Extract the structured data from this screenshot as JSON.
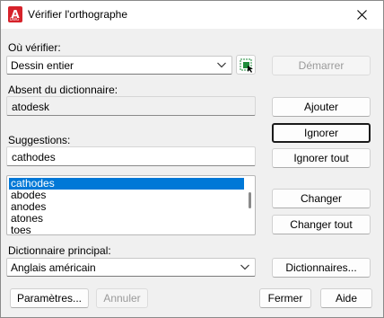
{
  "window": {
    "title": "Vérifier l'orthographe",
    "app_icon_letter": "A",
    "app_icon_sub": "DWG"
  },
  "where_to_check": {
    "label": "Où vérifier:",
    "value": "Dessin entier",
    "start_button": "Démarrer"
  },
  "not_in_dictionary": {
    "label": "Absent du dictionnaire:",
    "value": "atodesk"
  },
  "suggestions": {
    "label": "Suggestions:",
    "value": "cathodes",
    "items": [
      "cathodes",
      "abodes",
      "anodes",
      "atones",
      "toes"
    ],
    "selected_index": 0
  },
  "actions": {
    "add": "Ajouter",
    "ignore": "Ignorer",
    "ignore_all": "Ignorer tout",
    "change": "Changer",
    "change_all": "Changer tout",
    "dictionaries": "Dictionnaires..."
  },
  "main_dictionary": {
    "label": "Dictionnaire principal:",
    "value": "Anglais américain"
  },
  "footer": {
    "settings": "Paramètres...",
    "undo": "Annuler",
    "close": "Fermer",
    "help": "Aide"
  },
  "colors": {
    "selection": "#0078d7",
    "app_icon": "#d6222a",
    "pick_icon": "#1e8c3a"
  }
}
